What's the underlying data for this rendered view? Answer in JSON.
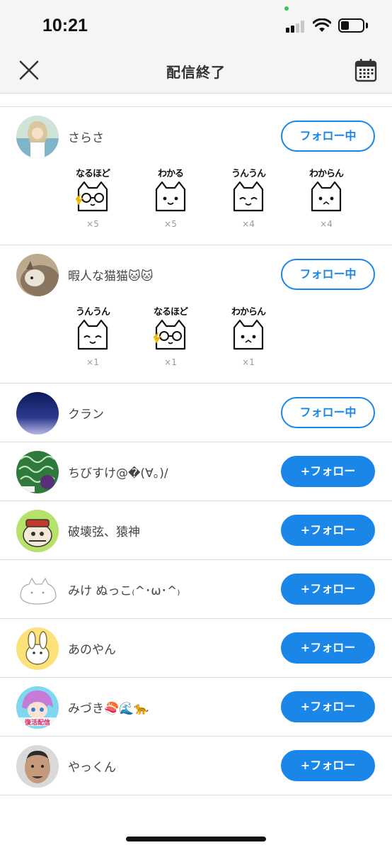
{
  "status_bar": {
    "time": "10:21"
  },
  "nav": {
    "title": "配信終了"
  },
  "viewers": [
    {
      "name": "さらさ",
      "button": "フォロー中",
      "following": true,
      "stamps": [
        {
          "label": "なるほど",
          "count": "×5",
          "glasses": true
        },
        {
          "label": "わかる",
          "count": "×5",
          "glasses": false
        },
        {
          "label": "うんうん",
          "count": "×4",
          "glasses": false
        },
        {
          "label": "わからん",
          "count": "×4",
          "glasses": false
        }
      ]
    },
    {
      "name": "暇人な猫猫🐱🐱",
      "button": "フォロー中",
      "following": true,
      "stamps": [
        {
          "label": "うんうん",
          "count": "×1",
          "glasses": false
        },
        {
          "label": "なるほど",
          "count": "×1",
          "glasses": true
        },
        {
          "label": "わからん",
          "count": "×1",
          "glasses": false
        }
      ]
    },
    {
      "name": "クラン",
      "button": "フォロー中",
      "following": true,
      "stamps": []
    },
    {
      "name": "ちびすけ@�(∀。)/",
      "button": "+フォロー",
      "following": false,
      "stamps": []
    },
    {
      "name": "破壊弦、猿神",
      "button": "+フォロー",
      "following": false,
      "stamps": []
    },
    {
      "name": "みけ ぬっこ₍^･ω･^₎",
      "button": "+フォロー",
      "following": false,
      "stamps": []
    },
    {
      "name": "あのやん",
      "button": "+フォロー",
      "following": false,
      "stamps": []
    },
    {
      "name": "みづき🍣🌊🐆",
      "button": "+フォロー",
      "following": false,
      "stamps": []
    },
    {
      "name": "やっくん",
      "button": "+フォロー",
      "following": false,
      "stamps": []
    }
  ],
  "avatar_badge": "復活配信",
  "colors": {
    "accent": "#1a86e8",
    "divider": "#dcdcdc",
    "header_bg": "#f5f5f5"
  }
}
